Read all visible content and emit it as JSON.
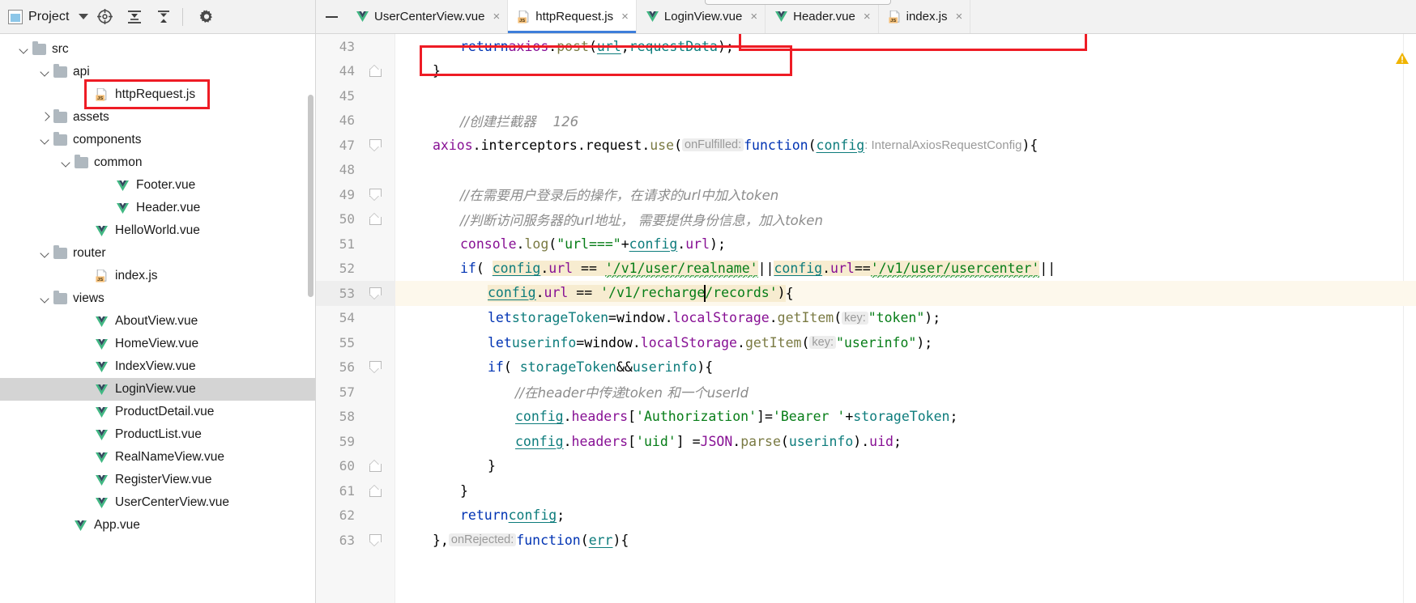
{
  "toolbar": {
    "project_label": "Project",
    "project_dropdown_icon": "chevron-down-icon",
    "locate_icon": "crosshair-target-icon",
    "expand_all_icon": "expand-all-icon",
    "collapse_all_icon": "collapse-all-icon",
    "settings_icon": "gear-icon",
    "hide_icon": "minimize-icon"
  },
  "tabs": [
    {
      "label": "UserCenterView.vue",
      "icon": "vue-file-icon",
      "active": false,
      "close": "×"
    },
    {
      "label": "httpRequest.js",
      "icon": "js-file-icon",
      "active": true,
      "close": "×"
    },
    {
      "label": "LoginView.vue",
      "icon": "vue-file-icon",
      "active": false,
      "close": "×"
    },
    {
      "label": "Header.vue",
      "icon": "vue-file-icon",
      "active": false,
      "close": "×"
    },
    {
      "label": "index.js",
      "icon": "js-file-icon",
      "active": false,
      "close": "×"
    }
  ],
  "tree": [
    {
      "label": "src",
      "type": "folder",
      "arrow": "down",
      "indent": 1,
      "selected": false
    },
    {
      "label": "api",
      "type": "folder",
      "arrow": "down",
      "indent": 2,
      "selected": false
    },
    {
      "label": "httpRequest.js",
      "type": "js",
      "arrow": "none",
      "indent": 4,
      "selected": false,
      "boxed": true
    },
    {
      "label": "assets",
      "type": "folder",
      "arrow": "right",
      "indent": 2,
      "selected": false
    },
    {
      "label": "components",
      "type": "folder",
      "arrow": "down",
      "indent": 2,
      "selected": false
    },
    {
      "label": "common",
      "type": "folder",
      "arrow": "down",
      "indent": 3,
      "selected": false
    },
    {
      "label": "Footer.vue",
      "type": "vue",
      "arrow": "none",
      "indent": 5,
      "selected": false
    },
    {
      "label": "Header.vue",
      "type": "vue",
      "arrow": "none",
      "indent": 5,
      "selected": false
    },
    {
      "label": "HelloWorld.vue",
      "type": "vue",
      "arrow": "none",
      "indent": 4,
      "selected": false
    },
    {
      "label": "router",
      "type": "folder",
      "arrow": "down",
      "indent": 2,
      "selected": false
    },
    {
      "label": "index.js",
      "type": "js",
      "arrow": "none",
      "indent": 4,
      "selected": false
    },
    {
      "label": "views",
      "type": "folder",
      "arrow": "down",
      "indent": 2,
      "selected": false
    },
    {
      "label": "AboutView.vue",
      "type": "vue",
      "arrow": "none",
      "indent": 4,
      "selected": false
    },
    {
      "label": "HomeView.vue",
      "type": "vue",
      "arrow": "none",
      "indent": 4,
      "selected": false
    },
    {
      "label": "IndexView.vue",
      "type": "vue",
      "arrow": "none",
      "indent": 4,
      "selected": false
    },
    {
      "label": "LoginView.vue",
      "type": "vue",
      "arrow": "none",
      "indent": 4,
      "selected": true
    },
    {
      "label": "ProductDetail.vue",
      "type": "vue",
      "arrow": "none",
      "indent": 4,
      "selected": false
    },
    {
      "label": "ProductList.vue",
      "type": "vue",
      "arrow": "none",
      "indent": 4,
      "selected": false
    },
    {
      "label": "RealNameView.vue",
      "type": "vue",
      "arrow": "none",
      "indent": 4,
      "selected": false
    },
    {
      "label": "RegisterView.vue",
      "type": "vue",
      "arrow": "none",
      "indent": 4,
      "selected": false
    },
    {
      "label": "UserCenterView.vue",
      "type": "vue",
      "arrow": "none",
      "indent": 4,
      "selected": false
    },
    {
      "label": "App.vue",
      "type": "vue",
      "arrow": "none",
      "indent": 3,
      "selected": false
    }
  ],
  "editor": {
    "file": "httpRequest.js",
    "first_line": 43,
    "last_line": 63,
    "highlighted_line": 53,
    "inlay_hints": [
      "onFulfilled:",
      "key:",
      "onRejected:"
    ],
    "type_hint": ": InternalAxiosRequestConfig",
    "lines": {
      "43": "        return axios.post(url, requestData);",
      "44": "    }",
      "45": "",
      "46": "    //创建拦截器    126",
      "47": "    axios.interceptors.request.use( onFulfilled: function(config : InternalAxiosRequestConfig ){",
      "48": "",
      "49": "        //在需要用户登录后的操作，在请求的url中加入token",
      "50": "        //判断访问服务器的url地址， 需要提供身份信息，加入token",
      "51": "        console.log(\"url===\"+config.url);",
      "52": "        if( config.url == '/v1/user/realname' || config.url=='/v1/user/usercenter' ||",
      "53": "            config.url == '/v1/recharge/records') {",
      "54": "            let storageToken = window.localStorage.getItem( key: \"token\");",
      "55": "            let userinfo = window.localStorage.getItem( key: \"userinfo\");",
      "56": "            if( storageToken && userinfo ){",
      "57": "                //在header中传递token 和一个userId",
      "58": "                config.headers['Authorization']='Bearer ' + storageToken;",
      "59": "                config.headers['uid'] = JSON.parse(userinfo).uid;",
      "60": "            }",
      "61": "        }",
      "62": "        return config;",
      "63": "    }, onRejected: function(err){"
    }
  },
  "annotations": {
    "box_color": "#ee1c25",
    "boxes": [
      "httpRequest-js-tree-item",
      "usercenter-condition",
      "recharge-records-condition"
    ]
  },
  "colors": {
    "accent_blue": "#3d7eda",
    "selection_gray": "#d4d4d4",
    "highlight_yellow": "#f7ecd0",
    "line_highlight": "#fdf8ec",
    "keyword": "#0033b3",
    "string": "#067d17",
    "comment": "#8c8c8c",
    "property": "#871094",
    "local_var": "#0d7c7c",
    "warning": "#f0b400"
  }
}
